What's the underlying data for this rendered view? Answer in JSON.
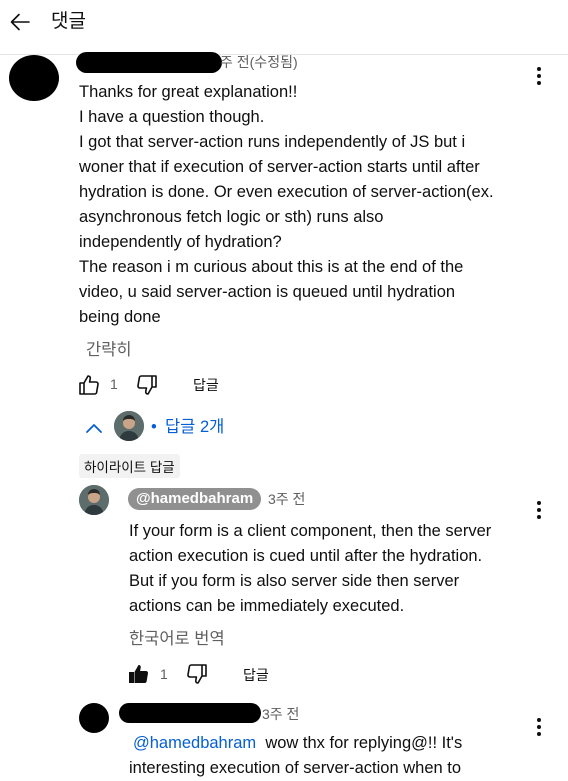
{
  "header": {
    "title": "댓글"
  },
  "comment": {
    "time_text": "주 전(수정됨)",
    "body_lines": [
      "Thanks for great explanation!!",
      "I have a question though.",
      "I got that server-action runs independently of JS but i",
      "woner that if execution of server-action starts until after",
      "hydration is done. Or even execution of server-action(ex.",
      "asynchronous fetch logic or sth) runs also",
      "independently of hydration?",
      "The reason i m curious about this is at the end of the",
      "video, u said server-action is queued until hydration",
      "being done"
    ],
    "collapse_label": "간략히",
    "like_count": "1",
    "reply_label": "답글",
    "replies_toggle": "답글 2개",
    "replies_separator": "•"
  },
  "highlight_tag": "하이라이트 답글",
  "reply1": {
    "author": "@hamedbahram",
    "time_text": "3주 전",
    "body_lines": [
      "If your form is a client component, then the server",
      "action execution is cued until after the hydration.",
      "But if you form is also server side then server",
      "actions can be immediately executed."
    ],
    "translate_label": "한국어로 번역",
    "like_count": "1",
    "reply_label": "답글"
  },
  "reply2": {
    "time_text": "3주 전",
    "mention": "@hamedbahram",
    "body_first": "wow thx for replying@!! It's",
    "body_second": "interesting execution of server-action when to"
  },
  "icons": {
    "back": "arrow-left-icon",
    "more": "more-vert-icon",
    "like": "thumb-up-icon",
    "dislike": "thumb-down-icon",
    "chevron": "chevron-up-icon"
  },
  "colors": {
    "link": "#065fd4",
    "muted": "#606060",
    "chip": "#909090"
  }
}
